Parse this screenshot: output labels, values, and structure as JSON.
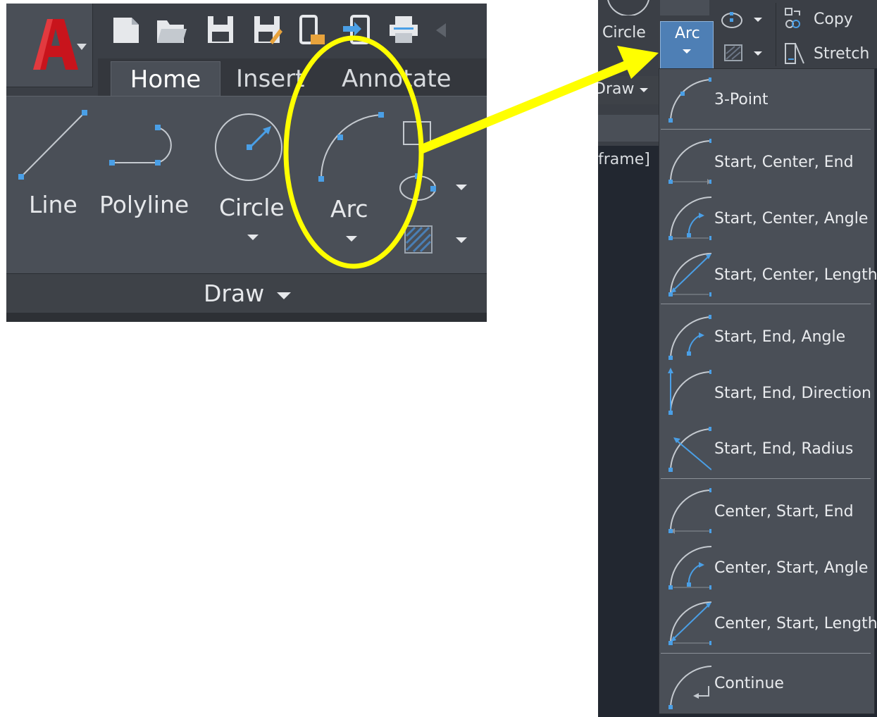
{
  "ribbon": {
    "tabs": [
      {
        "label": "Home"
      },
      {
        "label": "Insert"
      },
      {
        "label": "Annotate"
      }
    ],
    "tools": [
      {
        "label": "Line"
      },
      {
        "label": "Polyline"
      },
      {
        "label": "Circle"
      },
      {
        "label": "Arc"
      }
    ],
    "panel_title": "Draw"
  },
  "right_ribbon": {
    "circle_label": "Circle",
    "arc_label": "Arc",
    "copy_label": "Copy",
    "stretch_label": "Stretch",
    "draw_label": "Draw",
    "frame_text": "frame]"
  },
  "arc_menu": {
    "items": [
      {
        "label": "3-Point"
      },
      {
        "label": "Start, Center, End"
      },
      {
        "label": "Start, Center, Angle"
      },
      {
        "label": "Start, Center, Length"
      },
      {
        "label": "Start, End, Angle"
      },
      {
        "label": "Start, End, Direction"
      },
      {
        "label": "Start, End, Radius"
      },
      {
        "label": "Center, Start, End"
      },
      {
        "label": "Center, Start, Angle"
      },
      {
        "label": "Center, Start, Length"
      },
      {
        "label": "Continue"
      }
    ]
  },
  "colors": {
    "highlight": "#ffff00",
    "accent_blue": "#4a9fe6",
    "app_logo": "#c8141c"
  }
}
